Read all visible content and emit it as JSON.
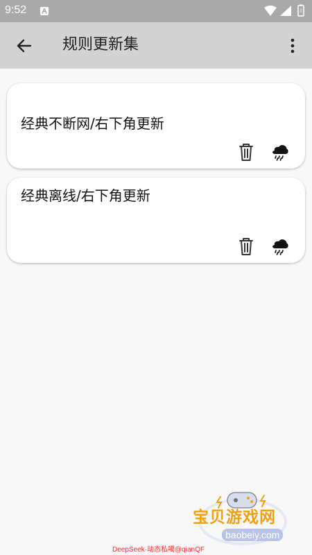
{
  "status_bar": {
    "time": "9:52"
  },
  "app_bar": {
    "title": "规则更新集",
    "back_icon": "arrow-left-icon",
    "menu_icon": "more-vertical-icon"
  },
  "rule_sets": [
    {
      "title": "经典不断网/右下角更新",
      "delete_icon": "trash-icon",
      "update_icon": "thunderstorm-cloud-icon"
    },
    {
      "title": "经典离线/右下角更新",
      "delete_icon": "trash-icon",
      "update_icon": "thunderstorm-cloud-icon"
    }
  ],
  "watermark": {
    "site_name": "宝贝游戏网",
    "domain": "baobeiy.com"
  },
  "footer": {
    "credit": "DeepSeek·动态私噶@qianQF"
  },
  "colors": {
    "status_bar": "#a9a9a9",
    "app_bar": "#d3d3d3",
    "background": "#f8f8f8",
    "card": "#ffffff",
    "watermark_orange": "#f2a012",
    "credit_red": "#ff2b2b"
  }
}
